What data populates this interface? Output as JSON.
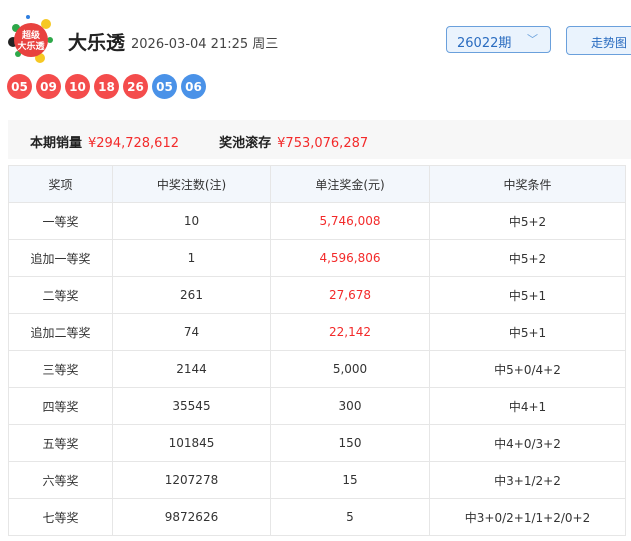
{
  "header": {
    "logo_text": "超级大乐透",
    "title": "大乐透",
    "datetime": "2026-03-04 21:25 周三",
    "issue_select": "26022期",
    "trend_button": "走势图"
  },
  "balls": {
    "red": [
      "05",
      "09",
      "10",
      "18",
      "26"
    ],
    "blue": [
      "05",
      "06"
    ]
  },
  "colors": {
    "red_ball": "#f44c4c",
    "blue_ball": "#4a92e8",
    "money": "#f32a2a"
  },
  "stats": {
    "sales_label": "本期销量",
    "sales_value": "¥294,728,612",
    "pool_label": "奖池滚存",
    "pool_value": "¥753,076,287"
  },
  "table": {
    "headers": [
      "奖项",
      "中奖注数(注)",
      "单注奖金(元)",
      "中奖条件"
    ],
    "rows": [
      [
        "一等奖",
        "10",
        "5,746,008",
        "中5+2"
      ],
      [
        "追加一等奖",
        "1",
        "4,596,806",
        "中5+2"
      ],
      [
        "二等奖",
        "261",
        "27,678",
        "中5+1"
      ],
      [
        "追加二等奖",
        "74",
        "22,142",
        "中5+1"
      ],
      [
        "三等奖",
        "2144",
        "5,000",
        "中5+0/4+2"
      ],
      [
        "四等奖",
        "35545",
        "300",
        "中4+1"
      ],
      [
        "五等奖",
        "101845",
        "150",
        "中4+0/3+2"
      ],
      [
        "六等奖",
        "1207278",
        "15",
        "中3+1/2+2"
      ],
      [
        "七等奖",
        "9872626",
        "5",
        "中3+0/2+1/1+2/0+2"
      ]
    ]
  }
}
